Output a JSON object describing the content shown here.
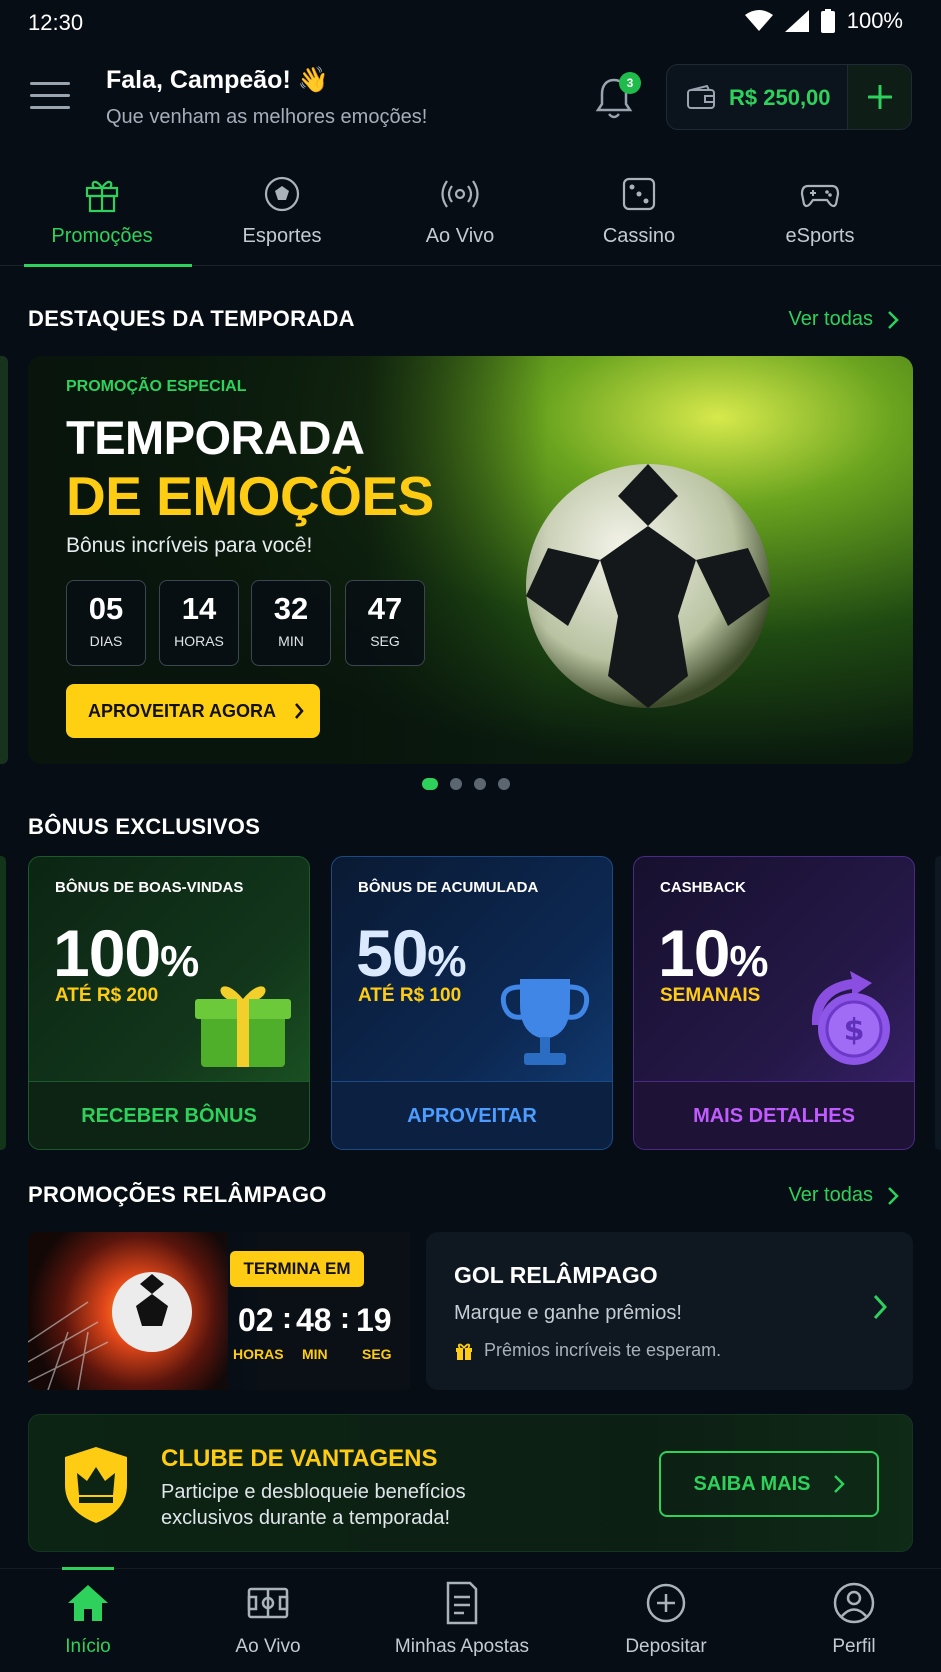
{
  "status_bar": {
    "time": "12:30",
    "battery": "100%"
  },
  "header": {
    "greeting": "Fala, Campeão! 👋",
    "subtitle": "Que venham as melhores emoções!",
    "notifications_count": "3",
    "balance": "R$ 250,00"
  },
  "tabs": [
    {
      "label": "Promoções",
      "icon": "gift-icon",
      "active": true
    },
    {
      "label": "Esportes",
      "icon": "soccer-ball-icon"
    },
    {
      "label": "Ao Vivo",
      "icon": "live-broadcast-icon"
    },
    {
      "label": "Cassino",
      "icon": "dice-icon"
    },
    {
      "label": "eSports",
      "icon": "gamepad-icon"
    }
  ],
  "highlights": {
    "title": "DESTAQUES DA TEMPORADA",
    "see_all": "Ver todas",
    "hero": {
      "tag": "PROMOÇÃO ESPECIAL",
      "title_line1": "TEMPORADA",
      "title_line2": "DE EMOÇÕES",
      "subtitle": "Bônus incríveis para você!",
      "countdown": [
        {
          "value": "05",
          "unit": "DIAS"
        },
        {
          "value": "14",
          "unit": "HORAS"
        },
        {
          "value": "32",
          "unit": "MIN"
        },
        {
          "value": "47",
          "unit": "SEG"
        }
      ],
      "cta": "APROVEITAR AGORA"
    },
    "carousel_active_index": 0,
    "carousel_count": 4
  },
  "bonuses": {
    "title": "BÔNUS EXCLUSIVOS",
    "cards": [
      {
        "title": "BÔNUS DE BOAS-VINDAS",
        "value": "100",
        "unit": "%",
        "sub": "ATÉ R$ 200",
        "button": "RECEBER BÔNUS",
        "icon": "gift-box-icon"
      },
      {
        "title": "BÔNUS DE ACUMULADA",
        "value": "50",
        "unit": "%",
        "sub": "ATÉ R$ 100",
        "button": "APROVEITAR",
        "icon": "trophy-icon"
      },
      {
        "title": "CASHBACK",
        "value": "10",
        "unit": "%",
        "sub": "SEMANAIS",
        "button": "MAIS DETALHES",
        "icon": "coin-icon"
      }
    ]
  },
  "flash": {
    "title": "PROMOÇÕES RELÂMPAGO",
    "see_all": "Ver todas",
    "badge": "TERMINA EM",
    "timer": [
      {
        "value": "02",
        "unit": "HORAS"
      },
      {
        "value": "48",
        "unit": "MIN"
      },
      {
        "value": "19",
        "unit": "SEG"
      }
    ],
    "card_title": "GOL RELÂMPAGO",
    "card_sub": "Marque e ganhe prêmios!",
    "card_note": "Prêmios incríveis te esperam."
  },
  "club": {
    "title": "CLUBE DE VANTAGENS",
    "line1": "Participe e desbloqueie benefícios",
    "line2": "exclusivos durante a temporada!",
    "cta": "SAIBA MAIS"
  },
  "bottom_nav": [
    {
      "label": "Início",
      "icon": "home-icon",
      "active": true
    },
    {
      "label": "Ao Vivo",
      "icon": "field-icon"
    },
    {
      "label": "Minhas Apostas",
      "icon": "bet-slip-icon"
    },
    {
      "label": "Depositar",
      "icon": "plus-circle-icon"
    },
    {
      "label": "Perfil",
      "icon": "user-icon"
    }
  ],
  "colors": {
    "accent": "#2ed15c",
    "gold": "#ffcc14",
    "background": "#070d15"
  }
}
